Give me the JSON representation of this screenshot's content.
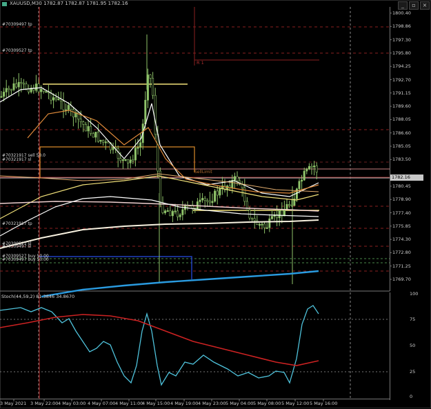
{
  "title_bar": {
    "symbol_period": "XAUUSD,M30",
    "ohlc": "1782.87 1782.87 1781.95 1782.16",
    "icon": "chart-window-icon",
    "buttons": [
      "minimize",
      "restore",
      "close"
    ]
  },
  "price_axis": {
    "labels": [
      "1800.40",
      "1798.86",
      "1797.30",
      "1795.80",
      "1794.25",
      "1792.70",
      "1791.15",
      "1789.60",
      "1788.05",
      "1786.60",
      "1785.05",
      "1783.50",
      "1782.16",
      "1780.45",
      "1778.90",
      "1777.40",
      "1775.85",
      "1774.30",
      "1772.80",
      "1771.25",
      "1769.70"
    ],
    "current_price": "1782.16"
  },
  "oscillator": {
    "title": "Stoch(44,59,2) 81.3846 34.8670",
    "levels": [
      "100",
      "75",
      "50",
      "25",
      "0"
    ]
  },
  "time_axis": {
    "labels": [
      "3 May 2021",
      "3 May 22:00",
      "4 May 03:00",
      "4 May 07:00",
      "4 May 11:00",
      "4 May 15:00",
      "4 May 19:00",
      "4 May 23:00",
      "5 May 04:00",
      "5 May 08:00",
      "5 May 12:00",
      "5 May 16:00"
    ]
  },
  "order_labels": [
    {
      "text": "#70309497 tp",
      "color": "#d8d8d8"
    },
    {
      "text": "#70309527 tp",
      "color": "#d8d8d8"
    },
    {
      "text": "#70321917 sell 50.0",
      "color": "#d8d8d8"
    },
    {
      "text": "#70321917 sl",
      "color": "#d8d8d8"
    },
    {
      "text": "#70321917 tp",
      "color": "#d8d8d8"
    },
    {
      "text": "#70309527 sl",
      "color": "#d8d8d8"
    },
    {
      "text": "#70309497 sl",
      "color": "#d8d8d8"
    },
    {
      "text": "#70309527 buy 50.00",
      "color": "#d8d8d8"
    },
    {
      "text": "#70309497 buy 50.00",
      "color": "#d8d8d8"
    }
  ],
  "chart_labels": {
    "r1": "R 1",
    "mid_label": "SellLimit"
  },
  "colors": {
    "background": "#000000",
    "candles": "#8fc46a",
    "price_line": "#c8c8c8",
    "grid_red": "#8b2020",
    "stoch_main": "#4fc3dc",
    "stoch_signal": "#cc2222",
    "ma_white": "#ffffff",
    "ma_yellow": "#f2e27a",
    "ma_orange": "#e08a3a",
    "ma_blue": "#2a9be0"
  }
}
